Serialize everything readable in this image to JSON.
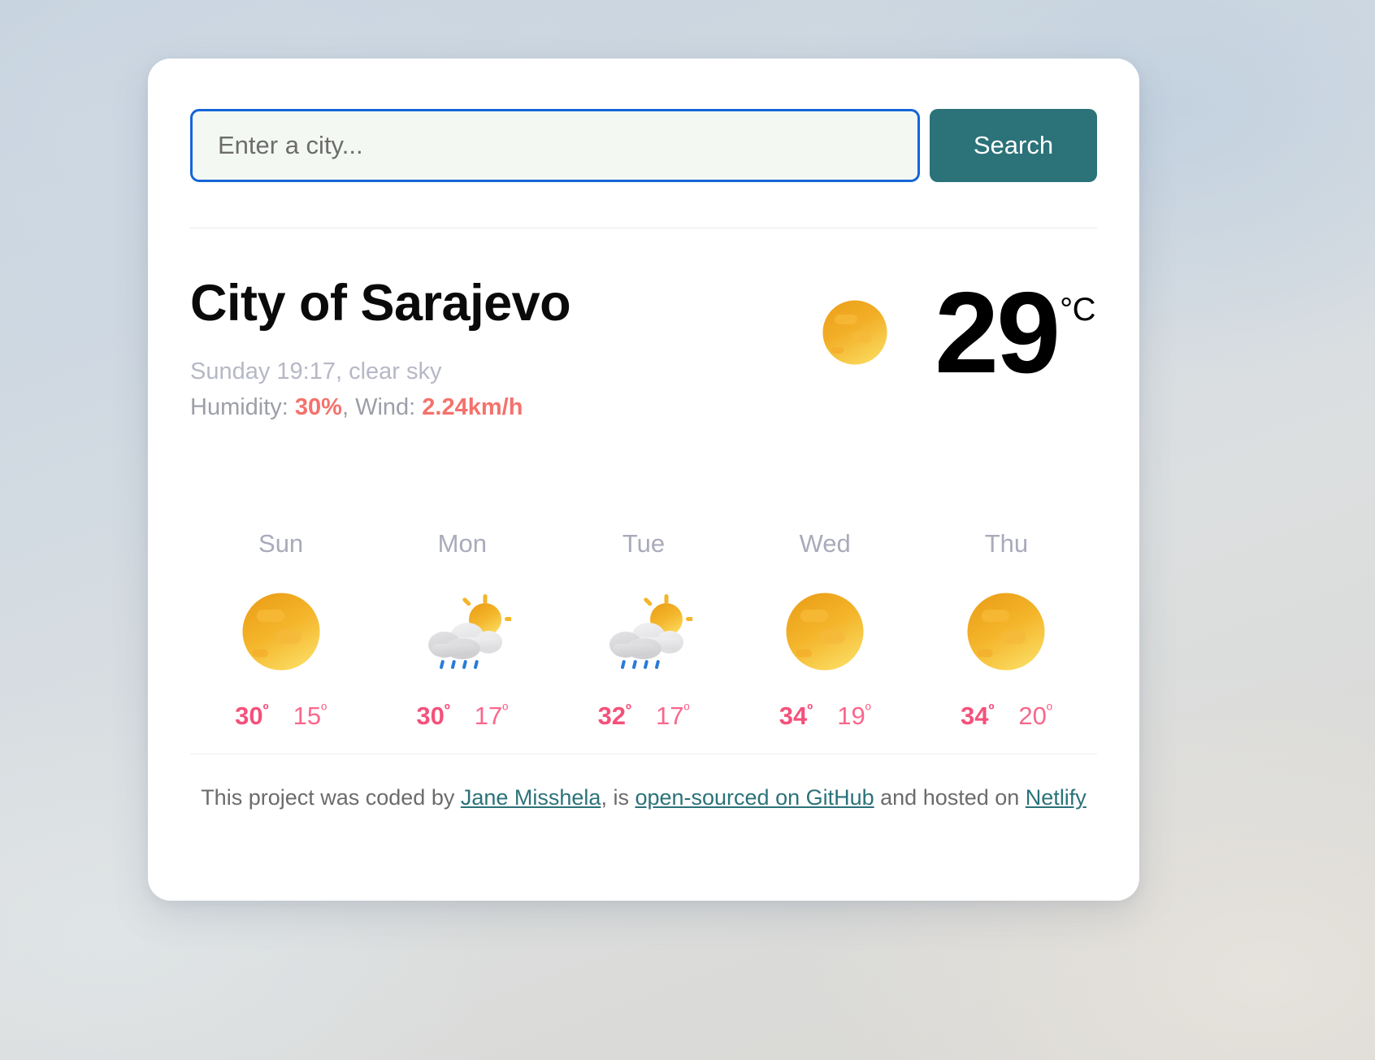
{
  "search": {
    "placeholder": "Enter a city...",
    "value": "",
    "button_label": "Search"
  },
  "current": {
    "city": "City of Sarajevo",
    "conditions": "Sunday 19:17, clear sky",
    "humidity_label": "Humidity: ",
    "humidity_value": "30%",
    "wind_label": ", Wind: ",
    "wind_value": "2.24km/h",
    "temperature": "29",
    "unit": "°C",
    "icon": "sun-icon"
  },
  "forecast": [
    {
      "day": "Sun",
      "icon": "sun-icon",
      "max": "30",
      "min": "15",
      "deg": "º"
    },
    {
      "day": "Mon",
      "icon": "rain-sun-icon",
      "max": "30",
      "min": "17",
      "deg": "º"
    },
    {
      "day": "Tue",
      "icon": "rain-sun-icon",
      "max": "32",
      "min": "17",
      "deg": "º"
    },
    {
      "day": "Wed",
      "icon": "sun-icon",
      "max": "34",
      "min": "19",
      "deg": "º"
    },
    {
      "day": "Thu",
      "icon": "sun-icon",
      "max": "34",
      "min": "20",
      "deg": "º"
    }
  ],
  "footer": {
    "part1": "This project was coded by ",
    "link1": "Jane Misshela",
    "part2": ", is ",
    "link2": "open-sourced on GitHub",
    "part3": " and hosted on ",
    "link3": "Netlify"
  },
  "colors": {
    "accent_teal": "#2b7279",
    "focus_blue": "#1565d8",
    "temp_pink": "#f4517b",
    "meta_red": "#f4726c",
    "sun_orange": "#f0a31c",
    "sun_yellow": "#f9d champion"
  }
}
